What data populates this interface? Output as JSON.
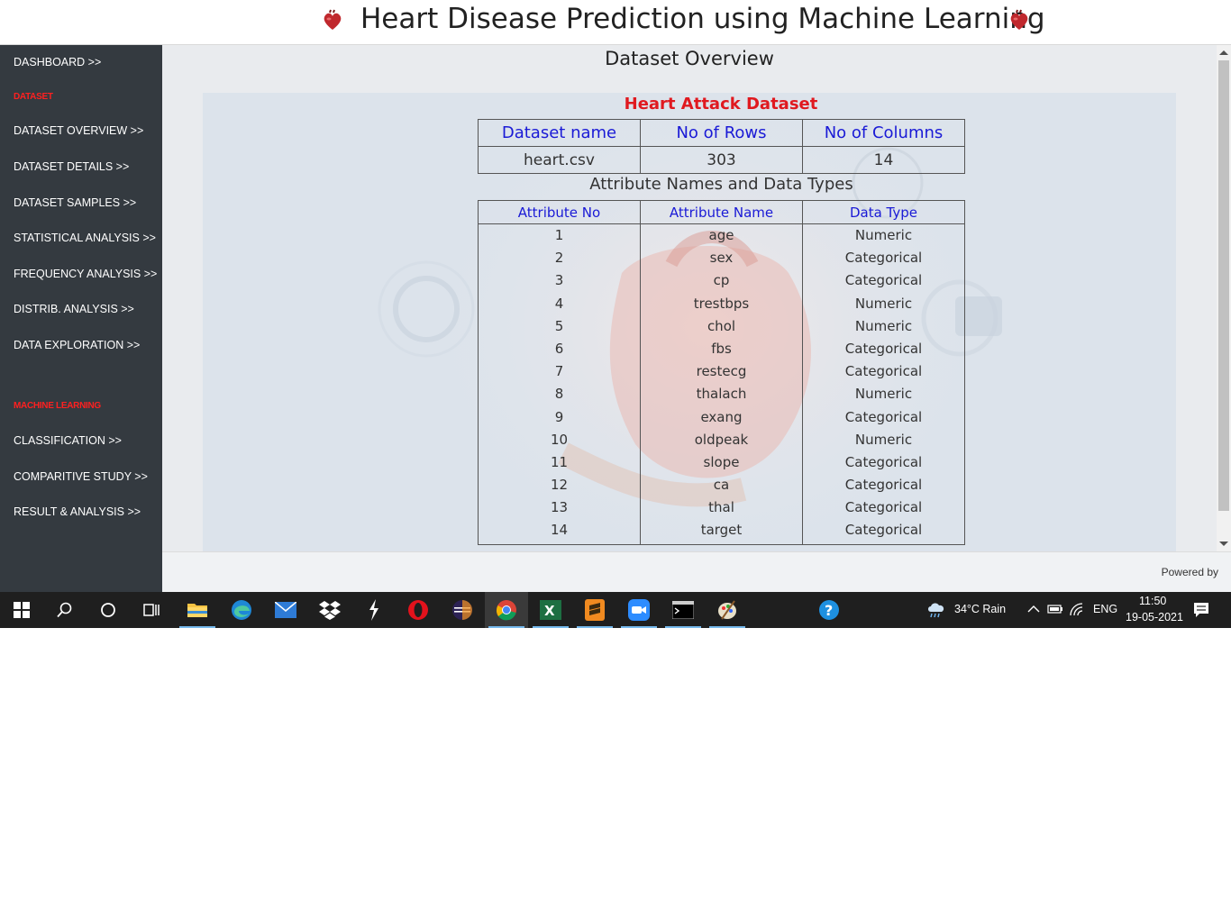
{
  "header": {
    "title": "Heart Disease Prediction using Machine Learning"
  },
  "sidebar": {
    "items": [
      {
        "label": "DASHBOARD >>",
        "type": "link"
      },
      {
        "label": "DATASET",
        "type": "heading"
      },
      {
        "label": "DATASET OVERVIEW >>",
        "type": "link"
      },
      {
        "label": "DATASET DETAILS >>",
        "type": "link"
      },
      {
        "label": "DATASET SAMPLES >>",
        "type": "link"
      },
      {
        "label": "STATISTICAL ANALYSIS >>",
        "type": "link"
      },
      {
        "label": "FREQUENCY ANALYSIS >>",
        "type": "link"
      },
      {
        "label": "DISTRIB. ANALYSIS >>",
        "type": "link"
      },
      {
        "label": "DATA EXPLORATION >>",
        "type": "link"
      },
      {
        "label": "MACHINE LEARNING",
        "type": "heading"
      },
      {
        "label": "CLASSIFICATION >>",
        "type": "link"
      },
      {
        "label": "COMPARITIVE STUDY >>",
        "type": "link"
      },
      {
        "label": "RESULT & ANALYSIS >>",
        "type": "link"
      }
    ]
  },
  "main": {
    "page_title": "Dataset Overview",
    "dataset_title": "Heart Attack Dataset",
    "summary": {
      "headers": [
        "Dataset name",
        "No of Rows",
        "No of Columns"
      ],
      "values": [
        "heart.csv",
        "303",
        "14"
      ]
    },
    "attributes_title": "Attribute Names and Data Types",
    "attributes": {
      "headers": [
        "Attribute No",
        "Attribute Name",
        "Data Type"
      ],
      "rows": [
        [
          "1",
          "age",
          "Numeric"
        ],
        [
          "2",
          "sex",
          "Categorical"
        ],
        [
          "3",
          "cp",
          "Categorical"
        ],
        [
          "4",
          "trestbps",
          "Numeric"
        ],
        [
          "5",
          "chol",
          "Numeric"
        ],
        [
          "6",
          "fbs",
          "Categorical"
        ],
        [
          "7",
          "restecg",
          "Categorical"
        ],
        [
          "8",
          "thalach",
          "Numeric"
        ],
        [
          "9",
          "exang",
          "Categorical"
        ],
        [
          "10",
          "oldpeak",
          "Numeric"
        ],
        [
          "11",
          "slope",
          "Categorical"
        ],
        [
          "12",
          "ca",
          "Categorical"
        ],
        [
          "13",
          "thal",
          "Categorical"
        ],
        [
          "14",
          "target",
          "Categorical"
        ]
      ]
    }
  },
  "footer": {
    "powered_by": "Powered by"
  },
  "taskbar": {
    "weather": "34°C  Rain",
    "language": "ENG",
    "time": "11:50",
    "date": "19-05-2021"
  },
  "colors": {
    "sidebar_bg": "#343a40",
    "heading_red": "#ff2020",
    "header_blue": "#1a1ad6",
    "title_red": "#e0191f"
  }
}
